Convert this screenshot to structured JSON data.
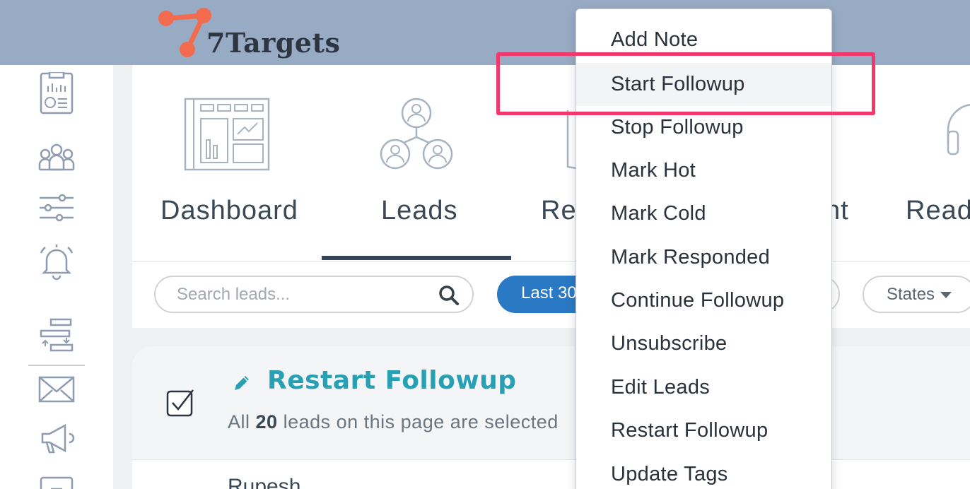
{
  "app": {
    "logo_text": "7Targets"
  },
  "nav": {
    "items": [
      {
        "label": "Dashboard",
        "icon": "dashboard-icon"
      },
      {
        "label": "Leads",
        "icon": "leads-icon"
      },
      {
        "label": "Res",
        "icon": "responses-icon"
      },
      {
        "label": "nt",
        "icon": ""
      },
      {
        "label": "Ready",
        "icon": "headset-icon"
      }
    ],
    "active": "Leads"
  },
  "sidebar": {
    "icons": [
      "report-icon",
      "team-icon",
      "sliders-icon",
      "bell-icon",
      "sequence-icon",
      "mail-icon",
      "megaphone-icon",
      "screen-icon"
    ]
  },
  "filters": {
    "search_placeholder": "Search leads...",
    "date_pill": "Last 30",
    "states_label": "States"
  },
  "selection": {
    "title": "Restart Followup",
    "sub_prefix": "All ",
    "count": "20",
    "sub_suffix": " leads on this page are selected"
  },
  "row": {
    "name": "Rupesh"
  },
  "menu": {
    "items": [
      "Add Note",
      "Start Followup",
      "Stop Followup",
      "Mark Hot",
      "Mark Cold",
      "Mark Responded",
      "Continue Followup",
      "Unsubscribe",
      "Edit Leads",
      "Restart Followup",
      "Update Tags"
    ],
    "highlighted": "Start Followup"
  },
  "colors": {
    "topbar": "#98abc4",
    "accent_blue": "#2a79c4",
    "title_teal": "#28a0b4",
    "highlight_pink": "#f0386b",
    "logo_orange": "#f26b4e"
  }
}
